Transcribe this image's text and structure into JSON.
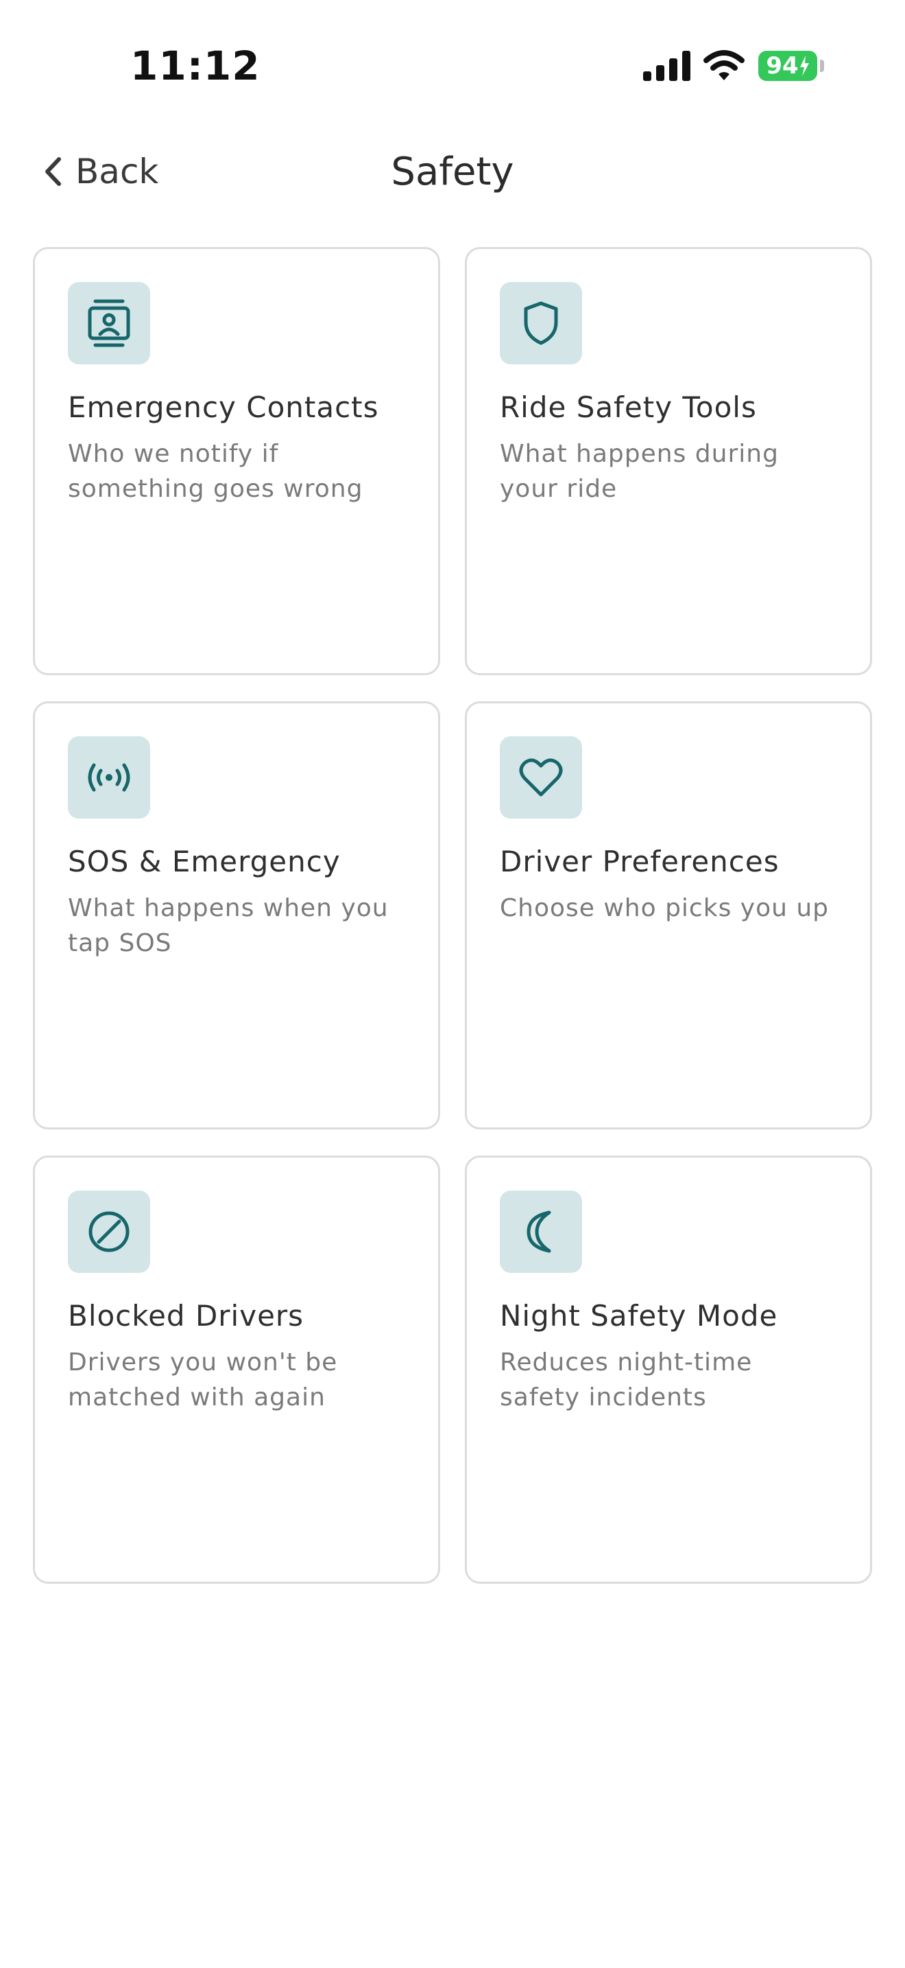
{
  "status_bar": {
    "time": "11:12",
    "battery_level": "94",
    "battery_color": "#34c759"
  },
  "nav": {
    "back_label": "Back",
    "title": "Safety"
  },
  "accent_color": "#16666b",
  "icon_tile_color": "#d3e5e6",
  "cards": [
    {
      "icon": "contacts-icon",
      "title": "Emergency Contacts",
      "description": "Who we notify if something goes wrong"
    },
    {
      "icon": "shield-icon",
      "title": "Ride Safety Tools",
      "description": "What happens during your ride"
    },
    {
      "icon": "broadcast-icon",
      "title": "SOS & Emergency",
      "description": "What happens when you tap SOS"
    },
    {
      "icon": "heart-icon",
      "title": "Driver Preferences",
      "description": "Choose who picks you up"
    },
    {
      "icon": "block-icon",
      "title": "Blocked Drivers",
      "description": "Drivers you won't be matched with again"
    },
    {
      "icon": "moon-icon",
      "title": "Night Safety Mode",
      "description": "Reduces night-time safety incidents"
    }
  ]
}
